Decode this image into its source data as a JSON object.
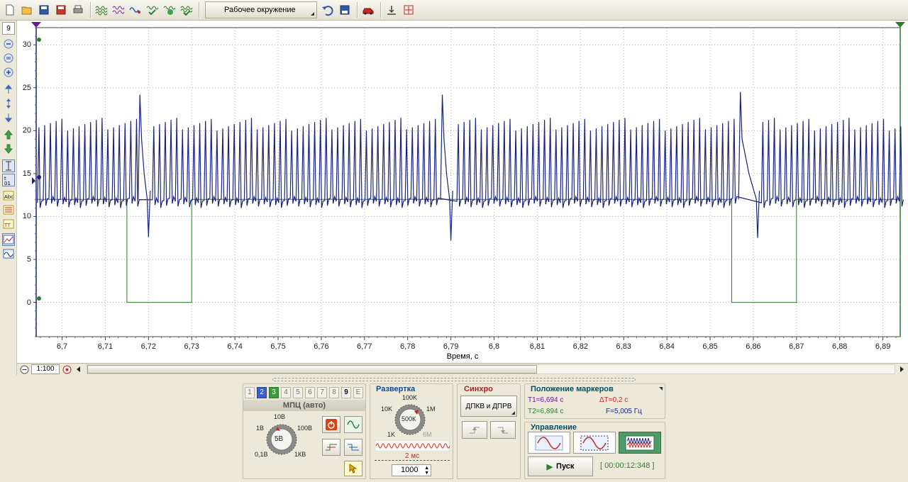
{
  "toolbar": {
    "workspace_label": "Рабочее окружение",
    "icons": [
      "new-file-icon",
      "open-folder-icon",
      "save-icon",
      "save-as-icon",
      "print-icon",
      "wave-1-icon",
      "wave-2-icon",
      "wave-3-icon",
      "wave-check-icon",
      "wave-number-icon",
      "wave-filter-icon",
      "undo-icon",
      "save-state-icon",
      "car-icon",
      "vertical-fit-icon",
      "horizontal-fit-icon"
    ]
  },
  "leftbar": {
    "channel_box": "9",
    "icons": [
      "zoom-out-icon",
      "zoom-reset-icon",
      "zoom-in-icon",
      "move-up-icon",
      "expand-vertical-icon",
      "move-down-icon",
      "arrow-up-icon",
      "arrow-down-icon",
      "cursor-vertical-icon",
      "cursor-numbers-icon",
      "text-abc-icon",
      "marker-icon",
      "text-tt-icon",
      "chart-view-icon",
      "wave-view-icon"
    ]
  },
  "plot": {
    "x_axis_label": "Время, с",
    "y_ticks": [
      "30",
      "25",
      "20",
      "15",
      "10",
      "5",
      "0"
    ],
    "x_ticks": [
      "6,7",
      "6,71",
      "6,72",
      "6,73",
      "6,74",
      "6,75",
      "6,76",
      "6,77",
      "6,78",
      "6,79",
      "6,8",
      "6,81",
      "6,82",
      "6,83",
      "6,84",
      "6,85",
      "6,86",
      "6,87",
      "6,88",
      "6,89"
    ],
    "colors": {
      "signal": "#1a237e",
      "reference": "#2e7d32",
      "grid": "#9cc79c"
    }
  },
  "chart_data": {
    "type": "line",
    "title": "",
    "xlabel": "Время, с",
    "ylabel": "",
    "xlim": [
      6.694,
      6.894
    ],
    "ylim": [
      -4,
      32
    ],
    "series": [
      {
        "color": "#1a237e",
        "pulse_band": [
          11,
          21.5
        ],
        "spikes": [
          {
            "x": 6.718,
            "y": 24.2
          },
          {
            "x": 6.788,
            "y": 24.2
          },
          {
            "x": 6.857,
            "y": 24.5
          }
        ],
        "dips": [
          {
            "x": 6.72,
            "y": 7.6
          },
          {
            "x": 6.79,
            "y": 7.2
          },
          {
            "x": 6.861,
            "y": 7.5
          }
        ]
      },
      {
        "color": "#2e7d32",
        "baseline": 12,
        "low_level": 0,
        "low_segments": [
          [
            6.715,
            6.73
          ],
          [
            6.855,
            6.87
          ]
        ]
      }
    ]
  },
  "bottom": {
    "zoom": "1:100"
  },
  "channel_panel": {
    "tabs": [
      "1",
      "2",
      "3",
      "4",
      "5",
      "6",
      "7",
      "8",
      "9",
      "E"
    ],
    "mode": "МПЦ (авто)",
    "knob_center": "5В",
    "knob_labels": [
      "10В",
      "1В",
      "100В",
      "0,1В",
      "1КВ"
    ]
  },
  "sweep_panel": {
    "title": "Развертка",
    "knob_center": "500К",
    "knob_labels": [
      "100K",
      "10K",
      "1M",
      "1K",
      "6M"
    ],
    "time_per_div": "2 мс",
    "points_value": "1000"
  },
  "sync_panel": {
    "title": "Синхро",
    "source": "ДПКВ и ДПРВ"
  },
  "markers_panel": {
    "title": "Положение маркеров",
    "t1": "T1=6,694 с",
    "t2": "T2=6,894 с",
    "dt": "ΔT=0,2 с",
    "freq": "F=5,005 Гц"
  },
  "control_panel": {
    "title": "Управление",
    "start_label": "Пуск",
    "elapsed": "[ 00:00:12:348 ]"
  }
}
